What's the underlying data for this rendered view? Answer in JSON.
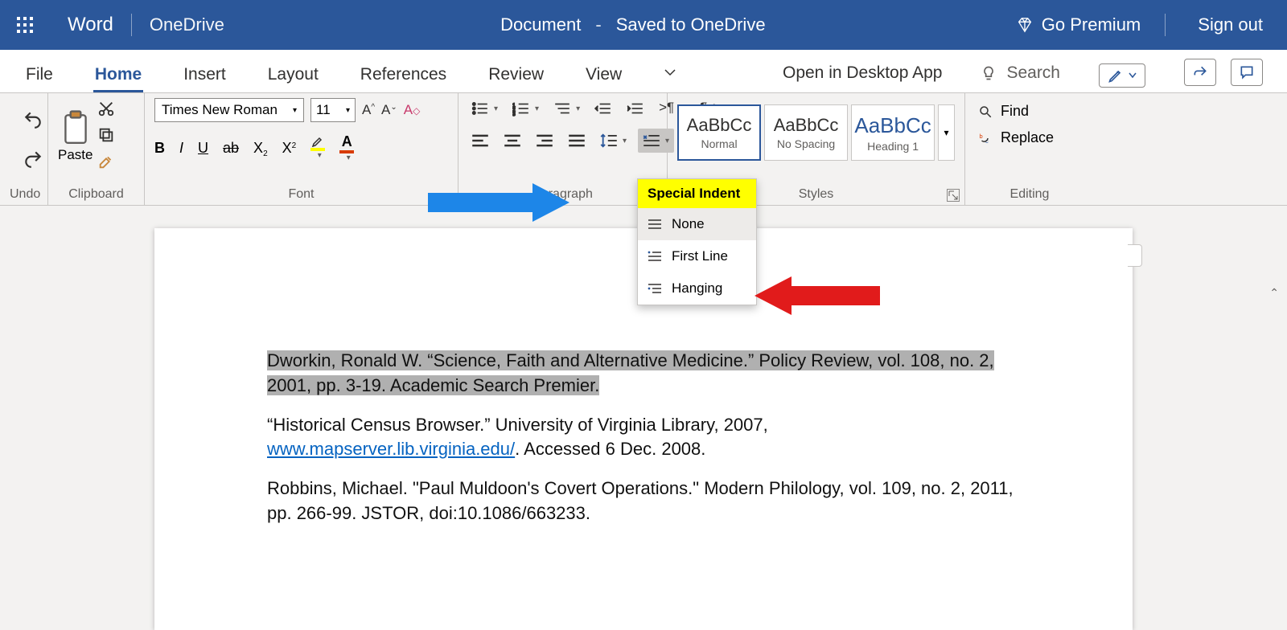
{
  "titlebar": {
    "brand": "Word",
    "onedrive": "OneDrive",
    "doc_name": "Document",
    "dash": "-",
    "save_state": "Saved to OneDrive",
    "premium": "Go Premium",
    "signout": "Sign out"
  },
  "tabs": {
    "file": "File",
    "home": "Home",
    "insert": "Insert",
    "layout": "Layout",
    "references": "References",
    "review": "Review",
    "view": "View",
    "open_desktop": "Open in Desktop App",
    "search_placeholder": "Search"
  },
  "ribbon": {
    "undo_label": "Undo",
    "clipboard_label": "Clipboard",
    "paste": "Paste",
    "font_label": "Font",
    "font_name": "Times New Roman",
    "font_size": "11",
    "para_label": "Paragraph",
    "styles_label": "Styles",
    "editing_label": "Editing",
    "style_normal": "Normal",
    "style_nospacing": "No Spacing",
    "style_heading1": "Heading 1",
    "style_sample": "AaBbCc",
    "find": "Find",
    "replace": "Replace"
  },
  "dropdown": {
    "header": "Special Indent",
    "none": "None",
    "first_line": "First Line",
    "hanging": "Hanging"
  },
  "document": {
    "p1": "Dworkin, Ronald W. “Science, Faith and Alternative Medicine.” Policy Review, vol. 108, no. 2, 2001, pp. 3-19. Academic Search Premier.",
    "p2_a": "“Historical Census Browser.” University of Virginia Library, 2007, ",
    "p2_link": "www.mapserver.lib.virginia.edu/",
    "p2_b": ". Accessed 6 Dec. 2008.",
    "p3": "Robbins, Michael. \"Paul Muldoon's Covert Operations.\" Modern Philology, vol. 109, no. 2, 2011, pp. 266-99. JSTOR, doi:10.1086/663233."
  }
}
